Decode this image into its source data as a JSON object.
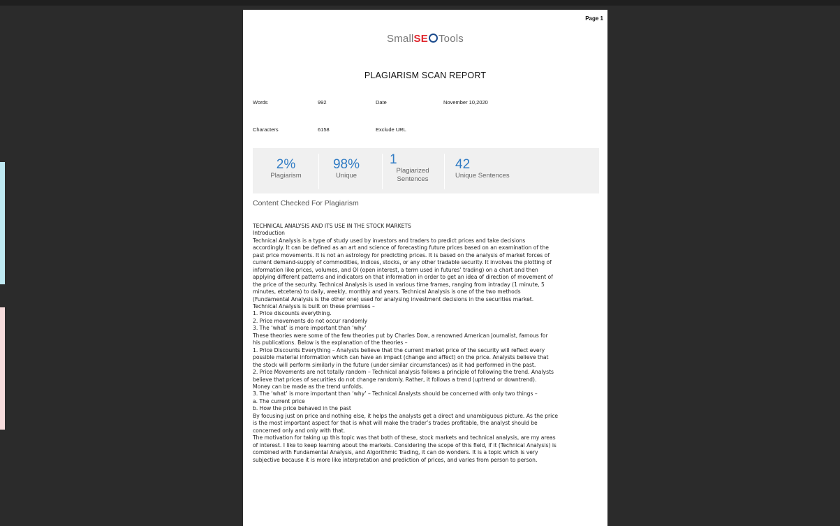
{
  "page_label": "Page 1",
  "logo": {
    "part1": "Small",
    "part2": "SE",
    "part3": "Tools"
  },
  "title": "PLAGIARISM SCAN REPORT",
  "meta": {
    "words_label": "Words",
    "words_value": "992",
    "date_label": "Date",
    "date_value": "November 10,2020",
    "characters_label": "Characters",
    "characters_value": "6158",
    "exclude_label": "Exclude URL"
  },
  "stats": {
    "plagiarism": {
      "value": "2%",
      "label": "Plagiarism"
    },
    "unique": {
      "value": "98%",
      "label": "Unique"
    },
    "plagiarized_sentences": {
      "value": "1",
      "label_line1": "Plagiarized",
      "label_line2": "Sentences"
    },
    "unique_sentences": {
      "value": "42",
      "label": "Unique Sentences"
    }
  },
  "content_heading": "Content Checked For Plagiarism",
  "body_lines": [
    "TECHNICAL ANALYSIS AND ITS USE IN THE STOCK MARKETS",
    "Introduction",
    "Technical Analysis is a type of study used by investors and traders to predict prices and take decisions",
    "accordingly. It can be defined as an art and science of forecasting future prices based on an examination of the",
    "past price movements. It is not an astrology for predicting prices. It is based on the analysis of market forces of",
    "current demand-supply of commodities, indices, stocks, or any other tradable security. It involves the plotting of",
    "information like prices, volumes, and OI (open interest, a term used in futures’ trading) on a chart and then",
    "applying different patterns and indicators on that information in order to get an idea of direction of movement of",
    "the price of the security. Technical Analysis is used in various time frames, ranging from intraday (1 minute, 5",
    "minutes, etcetera) to daily, weekly, monthly and years. Technical Analysis is one of the two methods",
    "(Fundamental Analysis is the other one) used for analysing investment decisions in the securities market.",
    "Technical Analysis is built on these premises –",
    "1. Price discounts everything.",
    "2. Price movements do not occur randomly",
    "3. The ‘what’ is more important than ‘why’",
    "These theories were some of the few theories put by Charles Dow, a renowned American Journalist, famous for",
    "his publications. Below is the explanation of the theories –",
    "1. Price Discounts Everything – Analysts believe that the current market price of the security will reflect every",
    "possible material information which can have an impact (change and affect) on the price. Analysts believe that",
    "the stock will perform similarly in the future (under similar circumstances) as it had performed in the past.",
    "2. Price Movements are not totally random – Technical analysis follows a principle of following the trend. Analysts",
    "believe that prices of securities do not change randomly. Rather, it follows a trend (uptrend or downtrend).",
    "Money can be made as the trend unfolds.",
    "3. The ‘what’ is more important than ‘why’ – Technical Analysts should be concerned with only two things –",
    "a. The current price",
    "b. How the price behaved in the past",
    "By focusing just on price and nothing else, it helps the analysts get a direct and unambiguous picture. As the price",
    "is the most important aspect for that is what will make the trader’s trades profitable, the analyst should be",
    "concerned only and only with that.",
    "The motivation for taking up this topic was that both of these, stock markets and technical analysis, are my areas",
    "of interest. I like to keep learning about the markets. Considering the scope of this field, if it (Technical Analysis) is",
    "combined with Fundamental Analysis, and Algorithmic Trading, it can do wonders. It is a topic which is very",
    "subjective because it is more like interpretation and prediction of prices, and varies from person to person."
  ]
}
